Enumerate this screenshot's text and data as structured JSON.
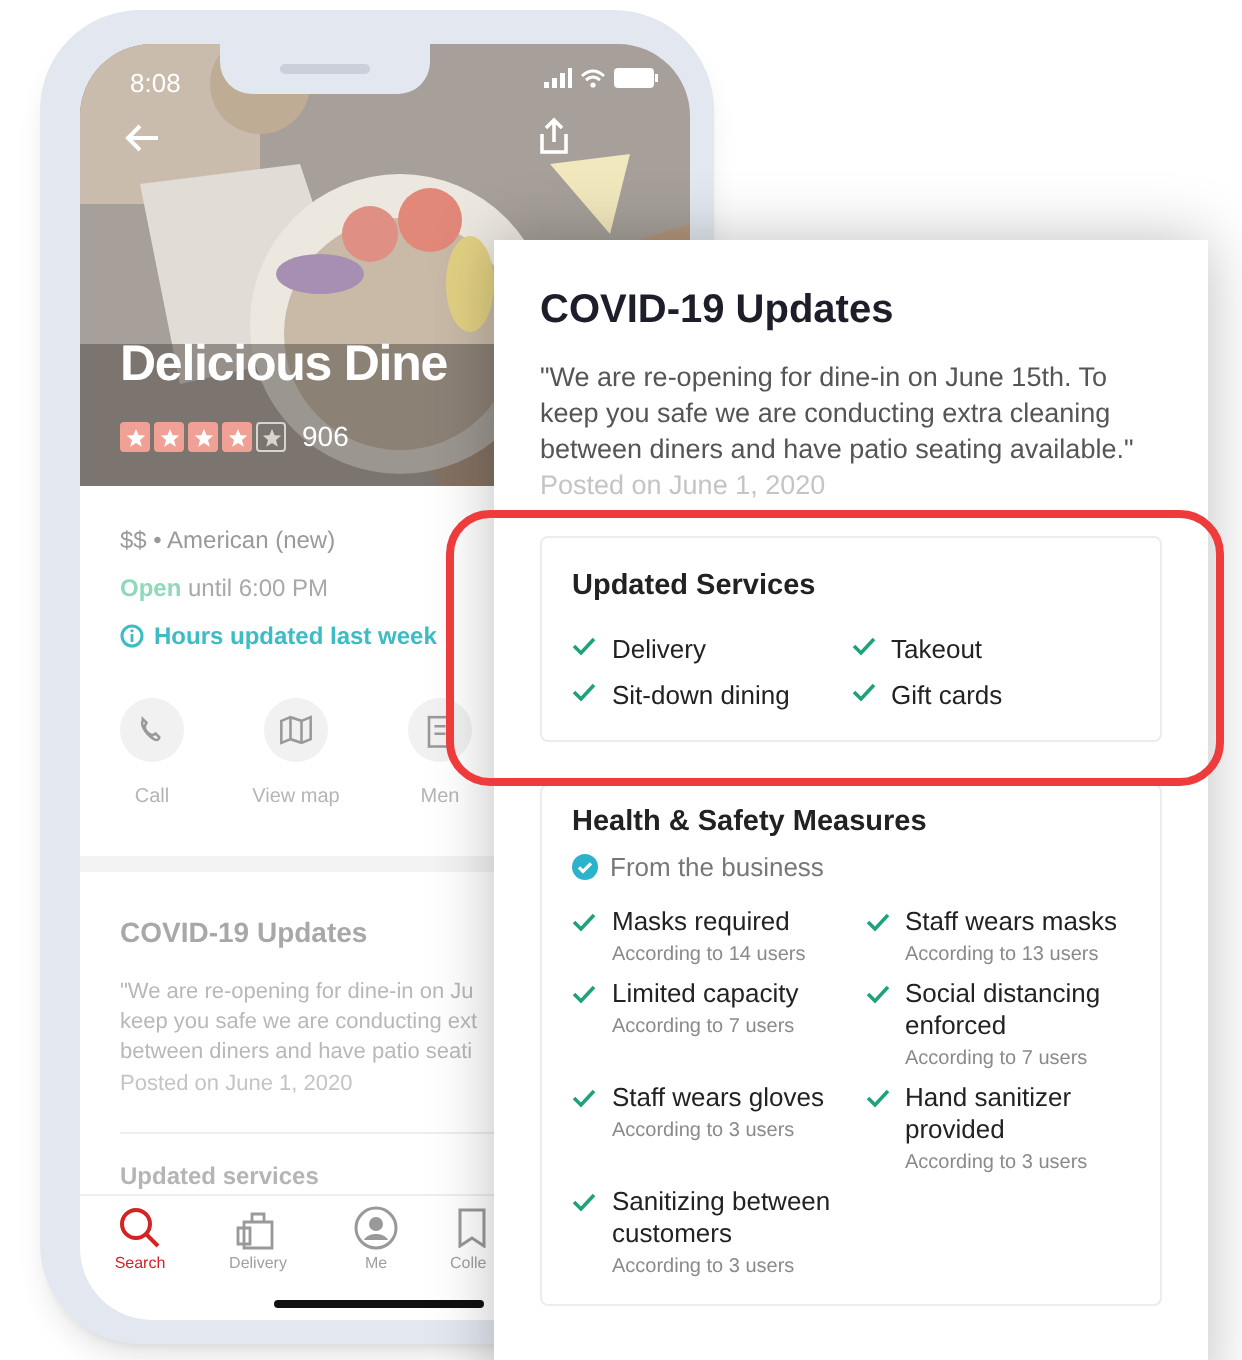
{
  "phone": {
    "status_time": "8:08",
    "business": {
      "name": "Delicious Dine",
      "stars": 4,
      "review_count": "906",
      "category": "$$ • American (new)",
      "open_label": "Open",
      "hours": "until 6:00 PM",
      "hours_notice": "Hours updated last week"
    },
    "actions": [
      {
        "kind": "call",
        "label": "Call"
      },
      {
        "kind": "map",
        "label": "View map"
      },
      {
        "kind": "menu",
        "label": "Men"
      }
    ],
    "covid": {
      "title": "COVID-19 Updates",
      "lines": [
        "\"We are re-opening for dine-in on Ju",
        "keep you safe we are conducting ext",
        "between diners and have patio seati"
      ],
      "posted": "Posted on June 1, 2020",
      "services_heading": "Updated services"
    },
    "tabs": [
      {
        "kind": "search",
        "label": "Search",
        "selected": true
      },
      {
        "kind": "delivery",
        "label": "Delivery",
        "selected": false
      },
      {
        "kind": "me",
        "label": "Me",
        "selected": false
      },
      {
        "kind": "collections",
        "label": "Colle",
        "selected": false
      }
    ]
  },
  "card": {
    "title": "COVID-19 Updates",
    "message": "\"We are re-opening for dine-in on June 15th. To keep you safe we are conducting extra cleaning between diners and have patio seating available.\"",
    "posted": "Posted on June 1, 2020",
    "services": {
      "heading": "Updated Services",
      "items": [
        "Delivery",
        "Takeout",
        "Sit-down dining",
        "Gift cards"
      ]
    },
    "health": {
      "heading": "Health & Safety Measures",
      "source": "From the business",
      "measures": [
        {
          "label": "Masks required",
          "note": "According to 14 users"
        },
        {
          "label": "Staff wears masks",
          "note": "According to 13 users"
        },
        {
          "label": "Limited capacity",
          "note": "According to 7 users"
        },
        {
          "label": "Social distancing enforced",
          "note": "According to 7 users"
        },
        {
          "label": "Staff wears gloves",
          "note": "According to 3 users"
        },
        {
          "label": "Hand sanitizer provided",
          "note": "According to 3 users"
        },
        {
          "label": "Sanitizing between customers",
          "note": "According to 3 users"
        }
      ]
    }
  }
}
